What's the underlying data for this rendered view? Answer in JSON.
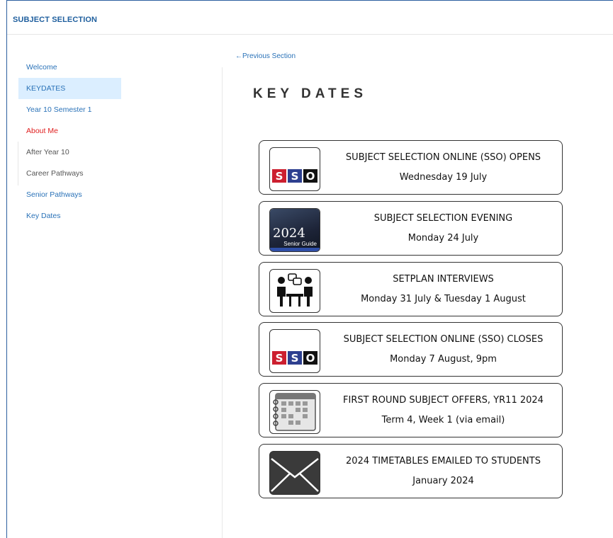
{
  "app": {
    "title": "SUBJECT SELECTION"
  },
  "sidebar": {
    "items": [
      {
        "label": "Welcome",
        "state": "normal"
      },
      {
        "label": "KEYDATES",
        "state": "active"
      },
      {
        "label": "Year 10 Semester 1",
        "state": "normal"
      },
      {
        "label": "About Me",
        "state": "highlight"
      },
      {
        "label": "After Year 10",
        "state": "muted"
      },
      {
        "label": "Career Pathways",
        "state": "muted"
      },
      {
        "label": "Senior Pathways",
        "state": "normal"
      },
      {
        "label": "Key Dates",
        "state": "normal"
      }
    ]
  },
  "main": {
    "prev_link": "←Previous Section",
    "title": "KEY DATES",
    "cards": [
      {
        "icon": "sso-logo-icon",
        "line1": "SUBJECT SELECTION ONLINE (SSO) OPENS",
        "line2": "Wednesday 19 July"
      },
      {
        "icon": "senior-guide-icon",
        "icon_text1": "2024",
        "icon_text2": "Senior Guide",
        "line1": "SUBJECT SELECTION EVENING",
        "line2": "Monday 24 July"
      },
      {
        "icon": "interview-icon",
        "line1": "SETPLAN INTERVIEWS",
        "line2": "Monday 31 July & Tuesday 1 August"
      },
      {
        "icon": "sso-logo-icon",
        "line1": "SUBJECT SELECTION ONLINE (SSO) CLOSES",
        "line2": "Monday 7 August, 9pm"
      },
      {
        "icon": "calendar-icon",
        "line1": "FIRST ROUND SUBJECT OFFERS, YR11 2024",
        "line2": "Term 4, Week 1  (via email)"
      },
      {
        "icon": "envelope-icon",
        "line1": "2024 TIMETABLES EMAILED TO STUDENTS",
        "line2": "January 2024"
      }
    ],
    "sso_letters": [
      "S",
      "S",
      "O"
    ]
  },
  "colors": {
    "accent": "#2a72b8",
    "active_bg": "#dbeeff",
    "alert": "#e02020",
    "sso_red": "#cc1f2f",
    "sso_blue": "#2d3f8f"
  }
}
